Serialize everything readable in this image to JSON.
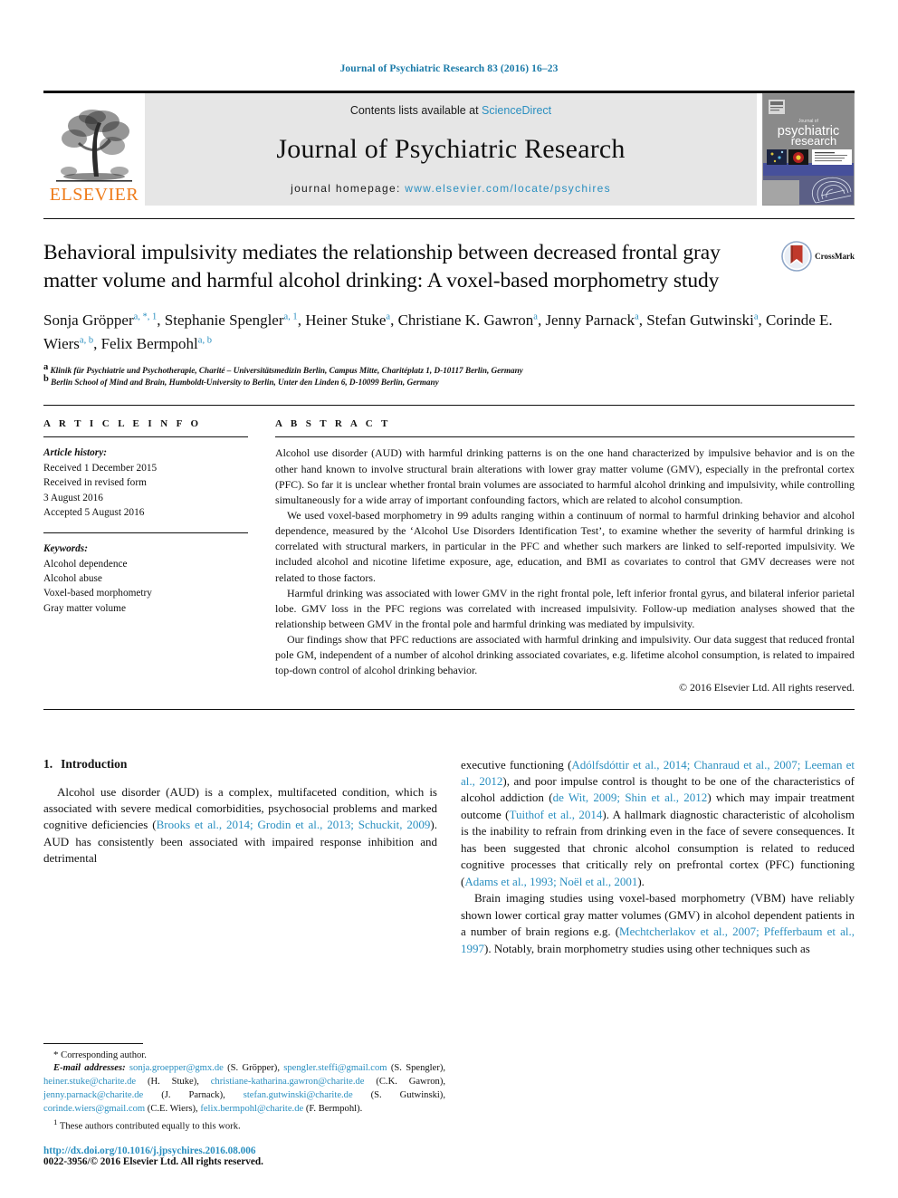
{
  "running_head": "Journal of Psychiatric Research 83 (2016) 16–23",
  "masthead": {
    "contents_prefix": "Contents lists available at ",
    "sciencedirect": "ScienceDirect",
    "journal_title": "Journal of Psychiatric Research",
    "homepage_prefix": "journal homepage: ",
    "homepage_url": "www.elsevier.com/locate/psychires",
    "publisher": "ELSEVIER",
    "cover_title_line1": "psychiatric",
    "cover_title_line2": "research",
    "cover_kicker": "Journal of"
  },
  "colors": {
    "link": "#2a8fc0",
    "running_head": "#1a7aa8",
    "elsevier_orange": "#ef7c1b",
    "masthead_gray": "#e6e6e6"
  },
  "article": {
    "title": "Behavioral impulsivity mediates the relationship between decreased frontal gray matter volume and harmful alcohol drinking: A voxel-based morphometry study",
    "crossmark_label": "CrossMark",
    "authors_line1": "Sonja Gröpper <a, *, 1>, Stephanie Spengler <a, 1>, Heiner Stuke <a>, Christiane K. Gawron <a>,",
    "authors_line2": "Jenny Parnack <a>, Stefan Gutwinski <a>, Corinde E. Wiers <a, b>, Felix Bermpohl <a, b>",
    "authors": [
      {
        "name": "Sonja Gröpper",
        "marks": "a, *, 1"
      },
      {
        "name": "Stephanie Spengler",
        "marks": "a, 1"
      },
      {
        "name": "Heiner Stuke",
        "marks": "a"
      },
      {
        "name": "Christiane K. Gawron",
        "marks": "a"
      },
      {
        "name": "Jenny Parnack",
        "marks": "a"
      },
      {
        "name": "Stefan Gutwinski",
        "marks": "a"
      },
      {
        "name": "Corinde E. Wiers",
        "marks": "a, b"
      },
      {
        "name": "Felix Bermpohl",
        "marks": "a, b"
      }
    ],
    "affiliations": [
      {
        "mark": "a",
        "text": "Klinik für Psychiatrie und Psychotherapie, Charité – Universitätsmedizin Berlin, Campus Mitte, Charitéplatz 1, D-10117 Berlin, Germany"
      },
      {
        "mark": "b",
        "text": "Berlin School of Mind and Brain, Humboldt-University to Berlin, Unter den Linden 6, D-10099 Berlin, Germany"
      }
    ]
  },
  "article_info": {
    "heading": "A R T I C L E  I N F O",
    "history_label": "Article history:",
    "history": [
      "Received 1 December 2015",
      "Received in revised form",
      "3 August 2016",
      "Accepted 5 August 2016"
    ],
    "keywords_label": "Keywords:",
    "keywords": [
      "Alcohol dependence",
      "Alcohol abuse",
      "Voxel-based morphometry",
      "Gray matter volume"
    ]
  },
  "abstract": {
    "heading": "A B S T R A C T",
    "paragraphs": [
      "Alcohol use disorder (AUD) with harmful drinking patterns is on the one hand characterized by impulsive behavior and is on the other hand known to involve structural brain alterations with lower gray matter volume (GMV), especially in the prefrontal cortex (PFC). So far it is unclear whether frontal brain volumes are associated to harmful alcohol drinking and impulsivity, while controlling simultaneously for a wide array of important confounding factors, which are related to alcohol consumption.",
      "We used voxel-based morphometry in 99 adults ranging within a continuum of normal to harmful drinking behavior and alcohol dependence, measured by the ‘Alcohol Use Disorders Identification Test’, to examine whether the severity of harmful drinking is correlated with structural markers, in particular in the PFC and whether such markers are linked to self-reported impulsivity. We included alcohol and nicotine lifetime exposure, age, education, and BMI as covariates to control that GMV decreases were not related to those factors.",
      "Harmful drinking was associated with lower GMV in the right frontal pole, left inferior frontal gyrus, and bilateral inferior parietal lobe. GMV loss in the PFC regions was correlated with increased impulsivity. Follow-up mediation analyses showed that the relationship between GMV in the frontal pole and harmful drinking was mediated by impulsivity.",
      "Our findings show that PFC reductions are associated with harmful drinking and impulsivity. Our data suggest that reduced frontal pole GM, independent of a number of alcohol drinking associated covariates, e.g. lifetime alcohol consumption, is related to impaired top-down control of alcohol drinking behavior."
    ],
    "copyright": "© 2016 Elsevier Ltd. All rights reserved."
  },
  "body": {
    "section_number": "1.",
    "section_title": "Introduction",
    "left_paragraph_segments": [
      {
        "t": "Alcohol use disorder (AUD) is a complex, multifaceted condition, which is associated with severe medical comorbidities, psychosocial problems and marked cognitive deficiencies (",
        "link": false
      },
      {
        "t": "Brooks et al., 2014; Grodin et al., 2013; Schuckit, 2009",
        "link": true
      },
      {
        "t": "). AUD has consistently been associated with impaired response inhibition and detrimental",
        "link": false
      }
    ],
    "right_paragraph1_segments": [
      {
        "t": "executive functioning (",
        "link": false
      },
      {
        "t": "Adólfsdóttir et al., 2014; Chanraud et al., 2007; Leeman et al., 2012",
        "link": true
      },
      {
        "t": "), and poor impulse control is thought to be one of the characteristics of alcohol addiction (",
        "link": false
      },
      {
        "t": "de Wit, 2009; Shin et al., 2012",
        "link": true
      },
      {
        "t": ") which may impair treatment outcome (",
        "link": false
      },
      {
        "t": "Tuithof et al., 2014",
        "link": true
      },
      {
        "t": "). A hallmark diagnostic characteristic of alcoholism is the inability to refrain from drinking even in the face of severe consequences. It has been suggested that chronic alcohol consumption is related to reduced cognitive processes that critically rely on prefrontal cortex (PFC) functioning (",
        "link": false
      },
      {
        "t": "Adams et al., 1993; Noël et al., 2001",
        "link": true
      },
      {
        "t": ").",
        "link": false
      }
    ],
    "right_paragraph2_segments": [
      {
        "t": "Brain imaging studies using voxel-based morphometry (VBM) have reliably shown lower cortical gray matter volumes (GMV) in alcohol dependent patients in a number of brain regions e.g. (",
        "link": false
      },
      {
        "t": "Mechtcherlakov et al., 2007; Pfefferbaum et al., 1997",
        "link": true
      },
      {
        "t": "). Notably, brain morphometry studies using other techniques such as",
        "link": false
      }
    ]
  },
  "footnotes": {
    "corresponding_marker": "*",
    "corresponding_text": "Corresponding author.",
    "email_label": "E-mail addresses:",
    "emails": [
      {
        "address": "sonja.groepper@gmx.de",
        "person": "(S. Gröpper)"
      },
      {
        "address": "spengler.steffi@gmail.com",
        "person": "(S. Spengler)"
      },
      {
        "address": "heiner.stuke@charite.de",
        "person": "(H. Stuke)"
      },
      {
        "address": "christiane-katharina.gawron@charite.de",
        "person": "(C.K. Gawron)"
      },
      {
        "address": "jenny.parnack@charite.de",
        "person": "(J. Parnack)"
      },
      {
        "address": "stefan.gutwinski@charite.de",
        "person": "(S. Gutwinski)"
      },
      {
        "address": "corinde.wiers@gmail.com",
        "person": "(C.E. Wiers)"
      },
      {
        "address": "felix.bermpohl@charite.de",
        "person": "(F. Bermpohl)"
      }
    ],
    "equal_contribution_marker": "1",
    "equal_contribution_text": "These authors contributed equally to this work.",
    "doi": "http://dx.doi.org/10.1016/j.jpsychires.2016.08.006",
    "issn_line": "0022-3956/© 2016 Elsevier Ltd. All rights reserved."
  }
}
